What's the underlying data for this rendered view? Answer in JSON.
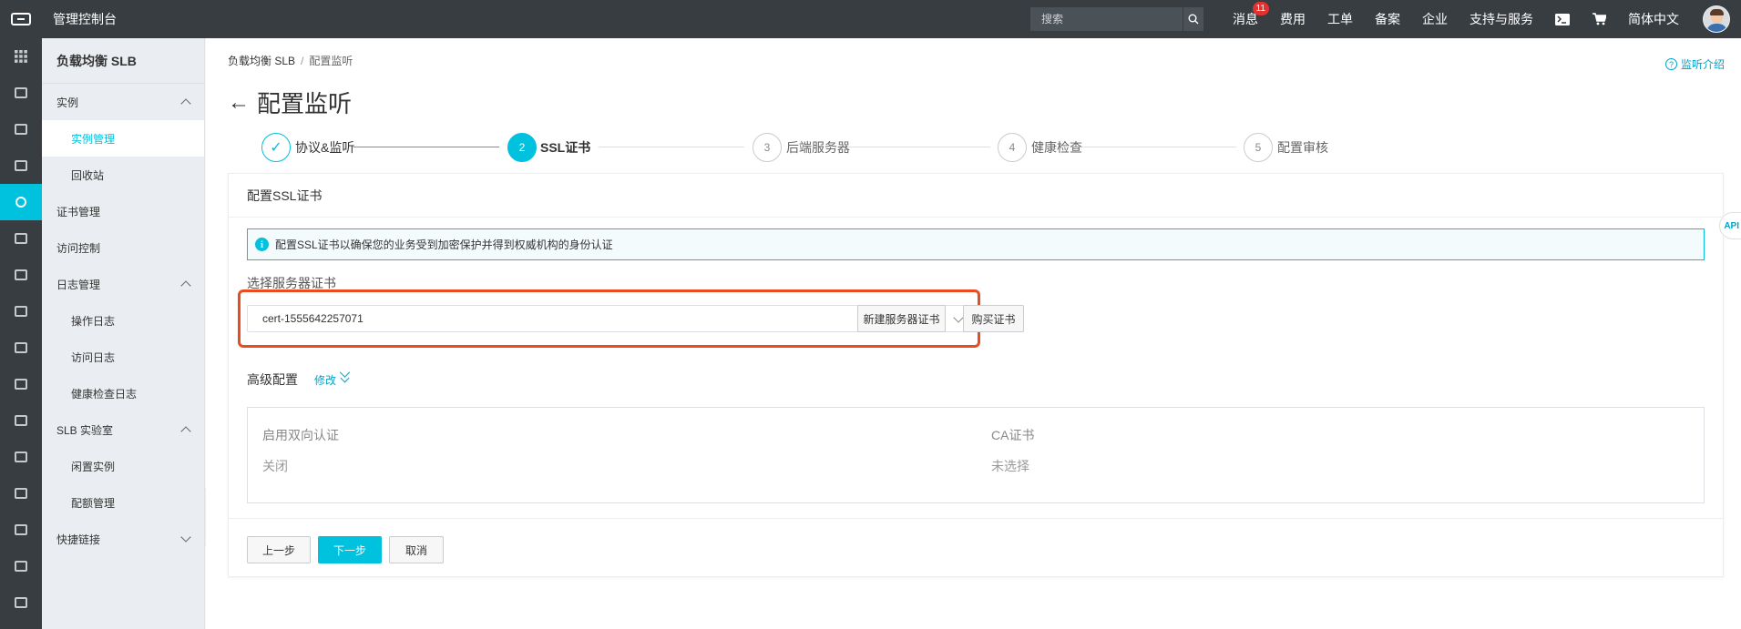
{
  "topbar": {
    "console_title": "管理控制台",
    "search_placeholder": "搜索",
    "nav": [
      {
        "label": "消息",
        "badge": "11"
      },
      {
        "label": "费用"
      },
      {
        "label": "工单"
      },
      {
        "label": "备案"
      },
      {
        "label": "企业"
      },
      {
        "label": "支持与服务"
      }
    ],
    "icons": [
      "terminal-icon",
      "cart-icon"
    ],
    "language": "简体中文"
  },
  "rail": {
    "icons": [
      "grid-icon",
      "server-list-icon",
      "database-icon",
      "cdn-icon",
      "slb-icon",
      "cloud-upload-icon",
      "network-icon",
      "cloud-icon",
      "cloud-storage-icon",
      "stack-icon",
      "chip-icon",
      "eye-icon",
      "satellite-icon",
      "tree-icon",
      "view-icon",
      "box-icon"
    ],
    "active_index": 4
  },
  "sidebar": {
    "title": "负载均衡 SLB",
    "items": [
      {
        "type": "group",
        "label": "实例",
        "expanded": true
      },
      {
        "type": "sub",
        "label": "实例管理",
        "active": true
      },
      {
        "type": "sub",
        "label": "回收站"
      },
      {
        "type": "group",
        "label": "证书管理"
      },
      {
        "type": "group",
        "label": "访问控制"
      },
      {
        "type": "group",
        "label": "日志管理",
        "expanded": true
      },
      {
        "type": "sub",
        "label": "操作日志"
      },
      {
        "type": "sub",
        "label": "访问日志"
      },
      {
        "type": "sub",
        "label": "健康检查日志"
      },
      {
        "type": "group",
        "label": "SLB 实验室",
        "expanded": true
      },
      {
        "type": "sub",
        "label": "闲置实例"
      },
      {
        "type": "sub",
        "label": "配额管理"
      },
      {
        "type": "group",
        "label": "快捷链接",
        "expanded": false
      }
    ]
  },
  "breadcrumb": {
    "parent": "负载均衡 SLB",
    "separator": "/",
    "current": "配置监听"
  },
  "help_link": "监听介绍",
  "page_title": "配置监听",
  "steps": [
    {
      "num": "✓",
      "label": "协议&监听",
      "state": "done"
    },
    {
      "num": "2",
      "label": "SSL证书",
      "state": "current"
    },
    {
      "num": "3",
      "label": "后端服务器",
      "state": "pending"
    },
    {
      "num": "4",
      "label": "健康检查",
      "state": "pending"
    },
    {
      "num": "5",
      "label": "配置审核",
      "state": "pending"
    }
  ],
  "card": {
    "header": "配置SSL证书",
    "info_icon": "i",
    "info_text": "配置SSL证书以确保您的业务受到加密保护并得到权威机构的身份认证",
    "field_label": "选择服务器证书",
    "selected_cert": "cert-1555642257071",
    "new_cert_button": "新建服务器证书",
    "buy_cert_button": "购买证书",
    "advanced_title": "高级配置",
    "modify_link": "修改",
    "advanced": [
      {
        "key": "启用双向认证",
        "value": "关闭"
      },
      {
        "key": "CA证书",
        "value": "未选择"
      }
    ],
    "footer_buttons": {
      "prev": "上一步",
      "next": "下一步",
      "cancel": "取消"
    }
  },
  "api_tab": "API",
  "colors": {
    "accent": "#00c1de",
    "topbar": "#373d41",
    "highlight": "#e84d21",
    "badge": "#e0332f"
  }
}
